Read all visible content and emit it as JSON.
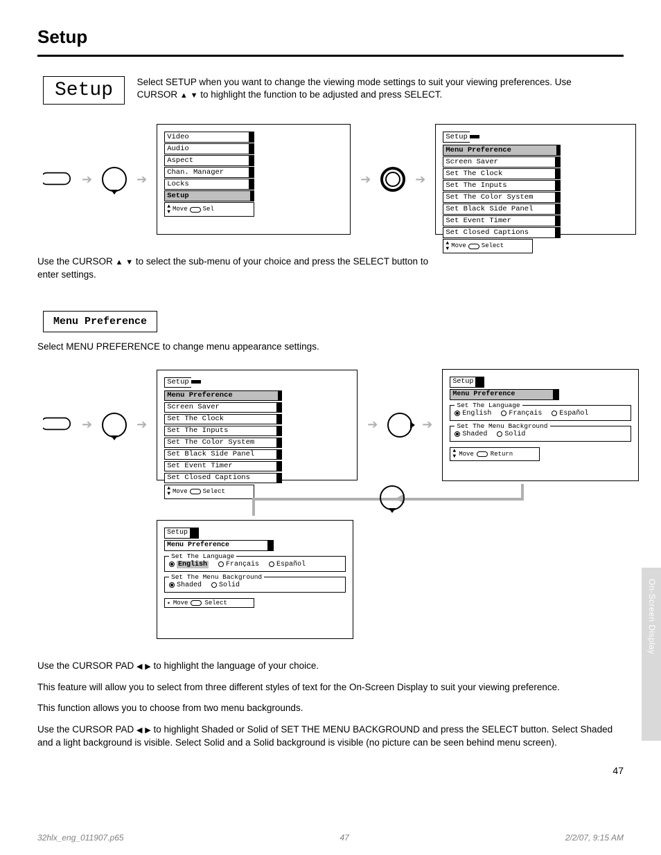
{
  "heading": "Setup",
  "section_title": "Setup",
  "intro_line1": "Select SETUP when you want to change the ",
  "intro_line2_a": "viewing mode settings to suit your viewing preferences. Use CURSOR ",
  "intro_line2_b": " to highlight ",
  "intro_line3": "the function to be adjusted and press SELECT.",
  "tri_up": "▲",
  "tri_down": "▼",
  "tri_left": "◀",
  "tri_right": "▶",
  "osd1": {
    "items": [
      "Video",
      "Audio",
      "Aspect",
      "Chan. Manager",
      "Locks",
      "Setup"
    ],
    "selected": "Setup",
    "hint_move": "Move",
    "hint_sel": "Sel"
  },
  "osd2": {
    "title": "Setup",
    "items": [
      "Menu Preference",
      "Screen Saver",
      "Set The Clock",
      "Set The Inputs",
      "Set The Color System",
      "Set Black Side Panel",
      "Set Event Timer",
      "Set Closed Captions"
    ],
    "selected": "Menu Preference",
    "hint_move": "Move",
    "hint_sel": "Select"
  },
  "after_flow_a": "Use the CURSOR ",
  "after_flow_b": " to select the sub-menu of your choice and press the SELECT button to ",
  "after_flow_c": "enter settings.",
  "sub_heading": "Menu Preference",
  "sub_desc": "Select MENU PREFERENCE to change menu appearance settings.",
  "osd3": {
    "title": "Setup",
    "items": [
      "Menu Preference",
      "Screen Saver",
      "Set The Clock",
      "Set The Inputs",
      "Set The Color System",
      "Set Black Side Panel",
      "Set Event Timer",
      "Set Closed Captions"
    ],
    "selected": "Menu Preference",
    "hint_move": "Move",
    "hint_sel": "Select"
  },
  "det": {
    "crumb1": "Setup",
    "crumb2": "Menu Preference",
    "lang_legend": "Set The Language",
    "lang_opts": [
      "English",
      "Français",
      "Español"
    ],
    "lang_sel": "English",
    "bg_legend": "Set The Menu Background",
    "bg_opts": [
      "Shaded",
      "Solid"
    ],
    "bg_sel": "Shaded",
    "hint_move": "Move",
    "hint_ret": "Return",
    "hint_sel": "Select"
  },
  "body_para1_a": "Use the CURSOR PAD ",
  "body_para1_b": " to highlight the language of your choice.",
  "body_para2": "This feature will allow you to select from three different styles of text for the On-Screen Display to suit your viewing preference.",
  "body_para3": "This function allows you to choose from two menu backgrounds.",
  "body_para4_a": "Use the CURSOR PAD ",
  "body_para4_b": " to highlight Shaded or Solid of SET THE MENU BACKGROUND and ",
  "body_para4_c": "press the SELECT button. Select Shaded and a light background is visible. Select Solid and a Solid background is visible (no picture can be seen behind menu screen).",
  "side_tab": "On-Screen Display",
  "page_num": "47",
  "footer_left": "2/2/07, 9:15 AM",
  "footer_mid": "47",
  "footer_right": "32hlx_eng_011907.p65"
}
